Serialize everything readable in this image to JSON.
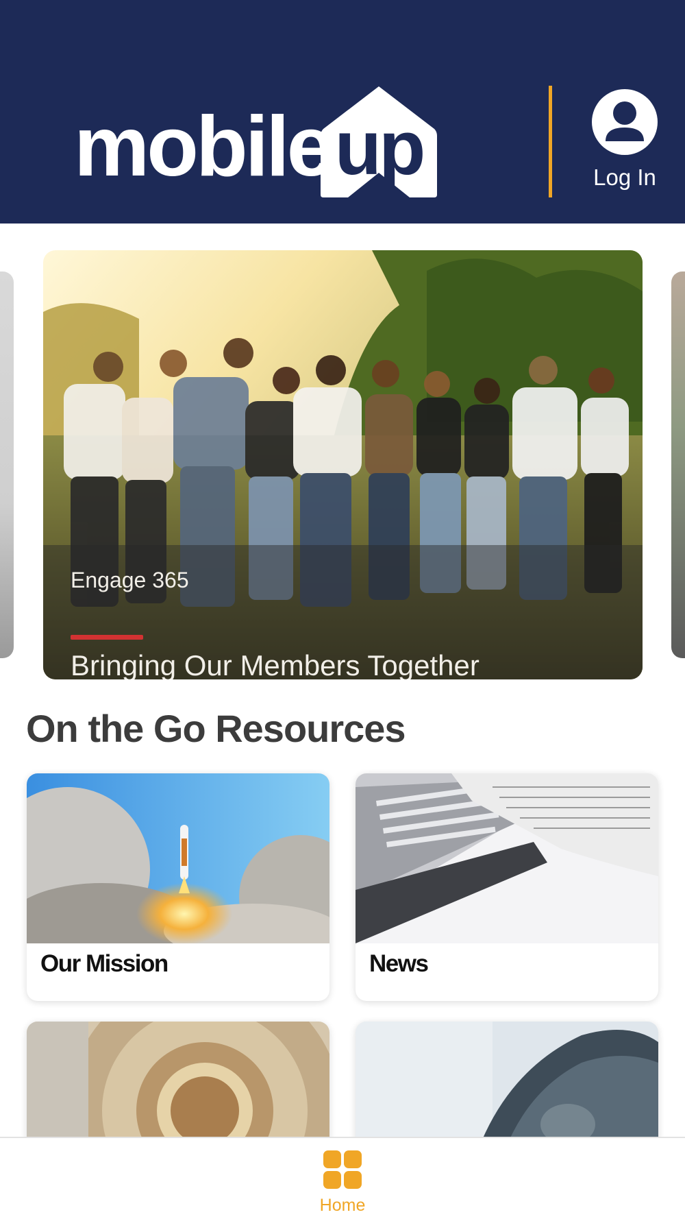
{
  "colors": {
    "header_bg": "#1d2a57",
    "accent": "#f0a626",
    "hero_rule": "#d23232",
    "section_title": "#3c3c3c"
  },
  "header": {
    "logo_text": "mobile",
    "logo_house_text": "up",
    "login_label": "Log In",
    "login_icon": "user-avatar-icon"
  },
  "carousel": {
    "active": {
      "kicker": "Engage 365",
      "title": "Bringing Our Members Together"
    }
  },
  "resources": {
    "title": "On the Go Resources",
    "items": [
      {
        "label": "Our Mission"
      },
      {
        "label": "News"
      },
      {
        "label": ""
      },
      {
        "label": ""
      }
    ]
  },
  "tabbar": {
    "items": [
      {
        "label": "Home",
        "icon": "grid-home-icon",
        "active": true
      }
    ]
  }
}
